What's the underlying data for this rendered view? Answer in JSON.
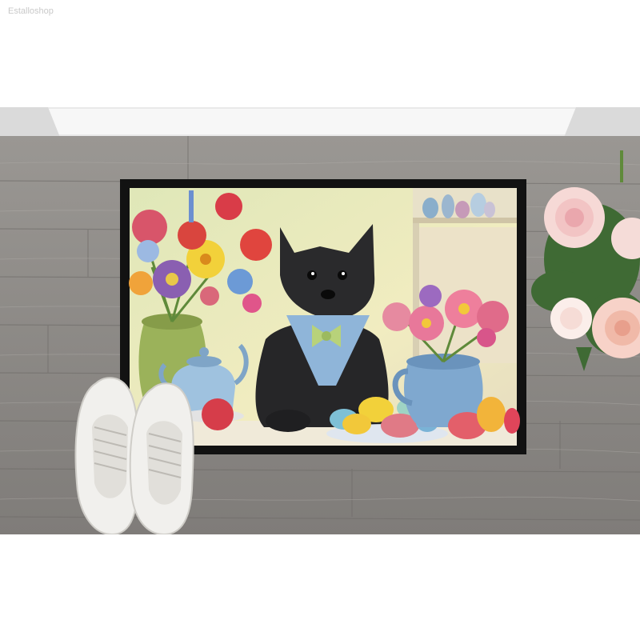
{
  "watermark": "Estalloshop",
  "scene": {
    "description_colors": {
      "floor": "#8d8a86",
      "mat_border": "#121212",
      "wall_trim": "#eeeeee"
    }
  }
}
